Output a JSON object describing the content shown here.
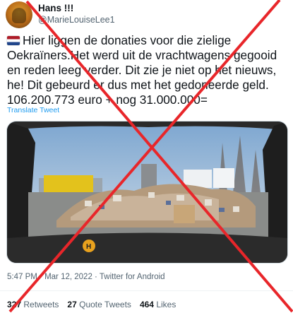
{
  "author": {
    "display_name": "Hans !!!",
    "handle": "@MarieLouiseLee1"
  },
  "tweet": {
    "text": "Hier liggen de donaties voor die zielige Oekraïners.Het werd uit de vrachtwagens gegooid en reden leeg verder. Dit zie je niet op het nieuws, he! Dit gebeurd er dus met het gedoneerde geld. 106.200.773 euro + nog 31.000.000=",
    "flag_icon": "netherlands-flag-icon",
    "translate_label": "Translate Tweet"
  },
  "meta": {
    "time": "5:47 PM",
    "date": "Mar 12, 2022",
    "source": "Twitter for Android",
    "separator": "·"
  },
  "stats": {
    "retweets_count": "327",
    "retweets_label": "Retweets",
    "quotes_count": "27",
    "quotes_label": "Quote Tweets",
    "likes_count": "464",
    "likes_label": "Likes"
  },
  "overlay": {
    "cross_color": "#e8262a"
  }
}
